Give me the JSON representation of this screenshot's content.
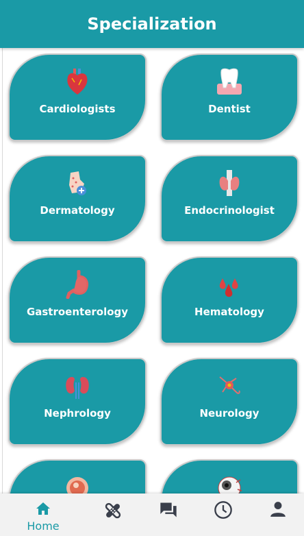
{
  "header": {
    "title": "Specialization"
  },
  "specializations": [
    {
      "label": "Cardiologists",
      "icon": "heart-icon"
    },
    {
      "label": "Dentist",
      "icon": "tooth-icon"
    },
    {
      "label": "Dermatology",
      "icon": "skin-icon"
    },
    {
      "label": "Endocrinologist",
      "icon": "thyroid-icon"
    },
    {
      "label": "Gastroenterology",
      "icon": "stomach-icon"
    },
    {
      "label": "Hematology",
      "icon": "blood-drops-icon"
    },
    {
      "label": "Nephrology",
      "icon": "kidneys-icon"
    },
    {
      "label": "Neurology",
      "icon": "neuron-icon"
    },
    {
      "label": "",
      "icon": "fetus-icon"
    },
    {
      "label": "",
      "icon": "eye-icon"
    }
  ],
  "bottom_nav": {
    "home_label": "Home",
    "items": [
      "home-icon",
      "bandage-icon",
      "chat-icon",
      "clock-icon",
      "profile-icon"
    ]
  },
  "colors": {
    "primary": "#1a9aa6",
    "nav_bg": "#f2f2f2"
  }
}
